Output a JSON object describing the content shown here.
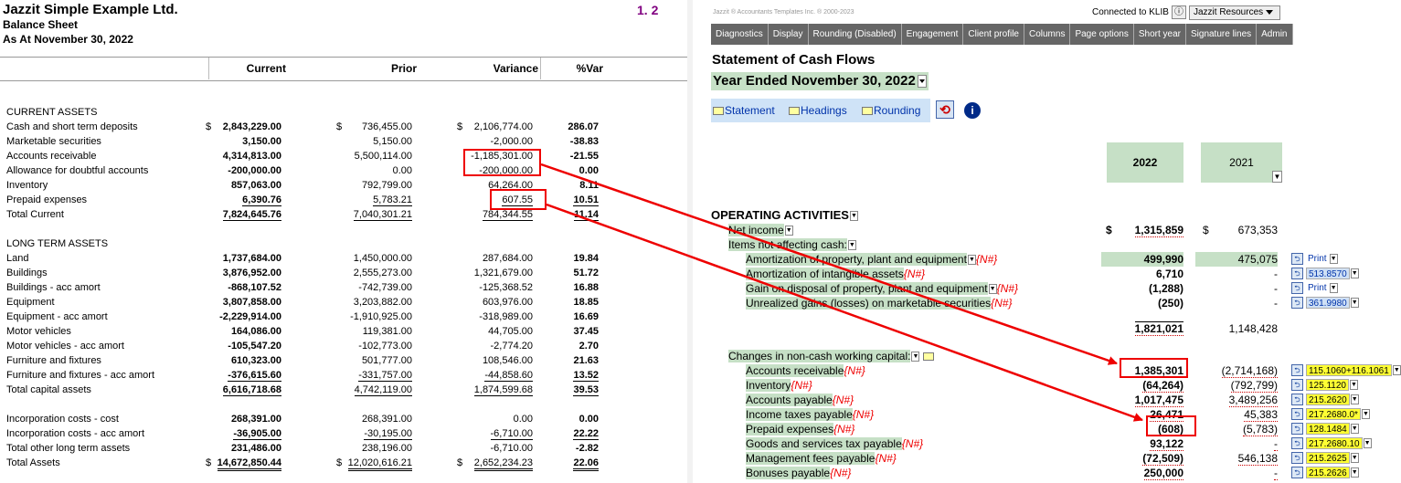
{
  "left": {
    "company": "Jazzit Simple Example Ltd.",
    "report": "Balance Sheet",
    "as_at": "As At November 30, 2022",
    "page_number": "1. 2",
    "columns": [
      "Current",
      "Prior",
      "Variance",
      "%Var"
    ],
    "current_assets_header": "CURRENT ASSETS",
    "current_assets": [
      {
        "label": "Cash and short term deposits",
        "current": "2,843,229.00",
        "prior": "736,455.00",
        "variance": "2,106,774.00",
        "pct": "286.07"
      },
      {
        "label": "Marketable securities",
        "current": "3,150.00",
        "prior": "5,150.00",
        "variance": "-2,000.00",
        "pct": "-38.83"
      },
      {
        "label": "Accounts receivable",
        "current": "4,314,813.00",
        "prior": "5,500,114.00",
        "variance": "-1,185,301.00",
        "pct": "-21.55"
      },
      {
        "label": "Allowance for doubtful accounts",
        "current": "-200,000.00",
        "prior": "0.00",
        "variance": "-200,000.00",
        "pct": "0.00"
      },
      {
        "label": "Inventory",
        "current": "857,063.00",
        "prior": "792,799.00",
        "variance": "64,264.00",
        "pct": "8.11"
      },
      {
        "label": "Prepaid expenses",
        "current": "6,390.76",
        "prior": "5,783.21",
        "variance": "607.55",
        "pct": "10.51"
      },
      {
        "label": "Total Current",
        "current": "7,824,645.76",
        "prior": "7,040,301.21",
        "variance": "784,344.55",
        "pct": "11.14"
      }
    ],
    "long_term_header": "LONG TERM ASSETS",
    "long_term": [
      {
        "label": "Land",
        "current": "1,737,684.00",
        "prior": "1,450,000.00",
        "variance": "287,684.00",
        "pct": "19.84"
      },
      {
        "label": "Buildings",
        "current": "3,876,952.00",
        "prior": "2,555,273.00",
        "variance": "1,321,679.00",
        "pct": "51.72"
      },
      {
        "label": "Buildings - acc amort",
        "current": "-868,107.52",
        "prior": "-742,739.00",
        "variance": "-125,368.52",
        "pct": "16.88"
      },
      {
        "label": "Equipment",
        "current": "3,807,858.00",
        "prior": "3,203,882.00",
        "variance": "603,976.00",
        "pct": "18.85"
      },
      {
        "label": "Equipment - acc amort",
        "current": "-2,229,914.00",
        "prior": "-1,910,925.00",
        "variance": "-318,989.00",
        "pct": "16.69"
      },
      {
        "label": "Motor vehicles",
        "current": "164,086.00",
        "prior": "119,381.00",
        "variance": "44,705.00",
        "pct": "37.45"
      },
      {
        "label": "Motor vehicles - acc amort",
        "current": "-105,547.20",
        "prior": "-102,773.00",
        "variance": "-2,774.20",
        "pct": "2.70"
      },
      {
        "label": "Furniture and fixtures",
        "current": "610,323.00",
        "prior": "501,777.00",
        "variance": "108,546.00",
        "pct": "21.63"
      },
      {
        "label": "Furniture and fixtures - acc amort",
        "current": "-376,615.60",
        "prior": "-331,757.00",
        "variance": "-44,858.60",
        "pct": "13.52"
      },
      {
        "label": "Total capital assets",
        "current": "6,616,718.68",
        "prior": "4,742,119.00",
        "variance": "1,874,599.68",
        "pct": "39.53"
      }
    ],
    "other": [
      {
        "label": "Incorporation costs - cost",
        "current": "268,391.00",
        "prior": "268,391.00",
        "variance": "0.00",
        "pct": "0.00"
      },
      {
        "label": "Incorporation costs - acc amort",
        "current": "-36,905.00",
        "prior": "-30,195.00",
        "variance": "-6,710.00",
        "pct": "22.22"
      },
      {
        "label": "Total other long term assets",
        "current": "231,486.00",
        "prior": "238,196.00",
        "variance": "-6,710.00",
        "pct": "-2.82"
      },
      {
        "label": "Total Assets",
        "current": "14,672,850.44",
        "prior": "12,020,616.21",
        "variance": "2,652,234.23",
        "pct": "22.06"
      }
    ],
    "dollar": "$"
  },
  "right": {
    "copyright": "Jazzit ® Accountants Templates Inc. ® 2000-2023",
    "connected": "Connected to KLIB",
    "info_btn": "ⓘ",
    "resources": "Jazzit Resources",
    "menu": [
      "Diagnostics",
      "Display",
      "Rounding (Disabled)",
      "Engagement",
      "Client profile",
      "Columns",
      "Page options",
      "Short year",
      "Signature lines",
      "Admin"
    ],
    "title": "Statement of Cash Flows",
    "year_ended": "Year Ended November 30, 2022",
    "tabs": [
      "Statement",
      "Headings",
      "Rounding"
    ],
    "year1": "2022",
    "year2": "2021",
    "nhash": "{N#}",
    "operating": "OPERATING ACTIVITIES",
    "net_income": {
      "label": "Net income",
      "v1": "1,315,859",
      "v2": "673,353"
    },
    "items_not": "Items not affecting cash:",
    "items": [
      {
        "label": "Amortization of property, plant and equipment",
        "v1": "499,990",
        "v2": "475,075",
        "side_link": "Print",
        "side": ""
      },
      {
        "label": "Amortization of intangible assets",
        "v1": "6,710",
        "v2": "-",
        "side_link": "",
        "side": "513.8570"
      },
      {
        "label": "Gain on disposal of property, plant and equipment",
        "v1": "(1,288)",
        "v2": "-",
        "side_link": "Print",
        "side": ""
      },
      {
        "label": "Unrealized gains (losses) on marketable securities",
        "v1": "(250)",
        "v2": "-",
        "side_link": "",
        "side": "361.9980"
      }
    ],
    "subtotal": {
      "v1": "1,821,021",
      "v2": "1,148,428"
    },
    "changes": "Changes in non-cash working capital:",
    "wc": [
      {
        "label": "Accounts receivable",
        "v1": "1,385,301",
        "v2": "(2,714,168)",
        "side": "115.1060+116.1061"
      },
      {
        "label": "Inventory",
        "v1": "(64,264)",
        "v2": "(792,799)",
        "side": "125.1120"
      },
      {
        "label": "Accounts payable",
        "v1": "1,017,475",
        "v2": "3,489,256",
        "side": "215.2620"
      },
      {
        "label": "Income taxes payable",
        "v1": "26,471",
        "v2": "45,383",
        "side": "217.2680.0*"
      },
      {
        "label": "Prepaid expenses",
        "v1": "(608)",
        "v2": "(5,783)",
        "side": "128.1484"
      },
      {
        "label": "Goods and services tax payable",
        "v1": "93,122",
        "v2": "-",
        "side": "217.2680.10"
      },
      {
        "label": "Management fees payable",
        "v1": "(72,509)",
        "v2": "546,138",
        "side": "215.2625"
      },
      {
        "label": "Bonuses payable",
        "v1": "250,000",
        "v2": "-",
        "side": "215.2626"
      }
    ],
    "dollar": "$"
  },
  "colors": {
    "highlight": "#c6e0c6",
    "annotation": "#ee0000",
    "menu": "#666666"
  }
}
